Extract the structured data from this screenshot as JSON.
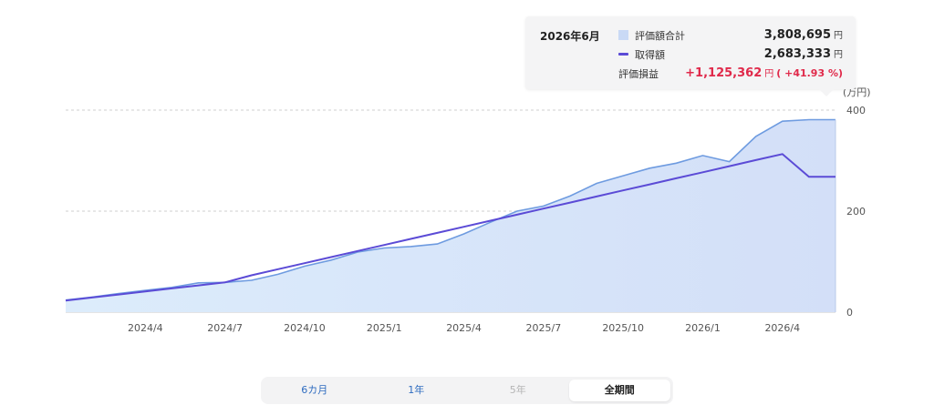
{
  "chart_data": {
    "type": "area",
    "y_unit": "(万円)",
    "ylim": [
      0,
      400
    ],
    "y_ticks": [
      0,
      200,
      400
    ],
    "x": [
      "2024/1",
      "2024/2",
      "2024/3",
      "2024/4",
      "2024/5",
      "2024/6",
      "2024/7",
      "2024/8",
      "2024/9",
      "2024/10",
      "2024/11",
      "2024/12",
      "2025/1",
      "2025/2",
      "2025/3",
      "2025/4",
      "2025/5",
      "2025/6",
      "2025/7",
      "2025/8",
      "2025/9",
      "2025/10",
      "2025/11",
      "2025/12",
      "2026/1",
      "2026/2",
      "2026/3",
      "2026/4",
      "2026/5",
      "2026/6"
    ],
    "x_tick_labels": [
      "2024/4",
      "2024/7",
      "2024/10",
      "2025/1",
      "2025/4",
      "2025/7",
      "2025/10",
      "2026/1",
      "2026/4"
    ],
    "series": [
      {
        "name": "評価額合計",
        "kind": "area",
        "color": "#6e9be0",
        "fill": "#d5e2f8",
        "values": [
          24,
          30,
          37,
          43,
          49,
          58,
          59,
          63,
          75,
          91,
          103,
          119,
          127,
          130,
          135,
          155,
          178,
          200,
          210,
          230,
          255,
          270,
          285,
          295,
          310,
          298,
          348,
          378,
          381,
          381
        ]
      },
      {
        "name": "取得額",
        "kind": "line",
        "color": "#5b4bd6",
        "values": [
          23,
          29,
          35,
          41,
          47,
          53,
          59,
          73,
          85,
          97,
          109,
          121,
          133,
          145,
          157,
          169,
          181,
          193,
          205,
          217,
          229,
          241,
          253,
          265,
          277,
          289,
          301,
          313,
          268,
          268
        ]
      }
    ],
    "grid": "dashed horizontal",
    "tooltip": {
      "date": "2026年6月",
      "rows": [
        {
          "label": "評価額合計",
          "value": "3,808,695",
          "unit": "円"
        },
        {
          "label": "取得額",
          "value": "2,683,333",
          "unit": "円"
        }
      ],
      "gain": {
        "label": "評価損益",
        "value": "+1,125,362",
        "unit": "円",
        "pct": "( +41.93 %)"
      }
    }
  },
  "range_selector": {
    "options": [
      {
        "label": "6カ月",
        "state": "enabled"
      },
      {
        "label": "1年",
        "state": "enabled"
      },
      {
        "label": "5年",
        "state": "disabled"
      },
      {
        "label": "全期間",
        "state": "selected"
      }
    ]
  }
}
